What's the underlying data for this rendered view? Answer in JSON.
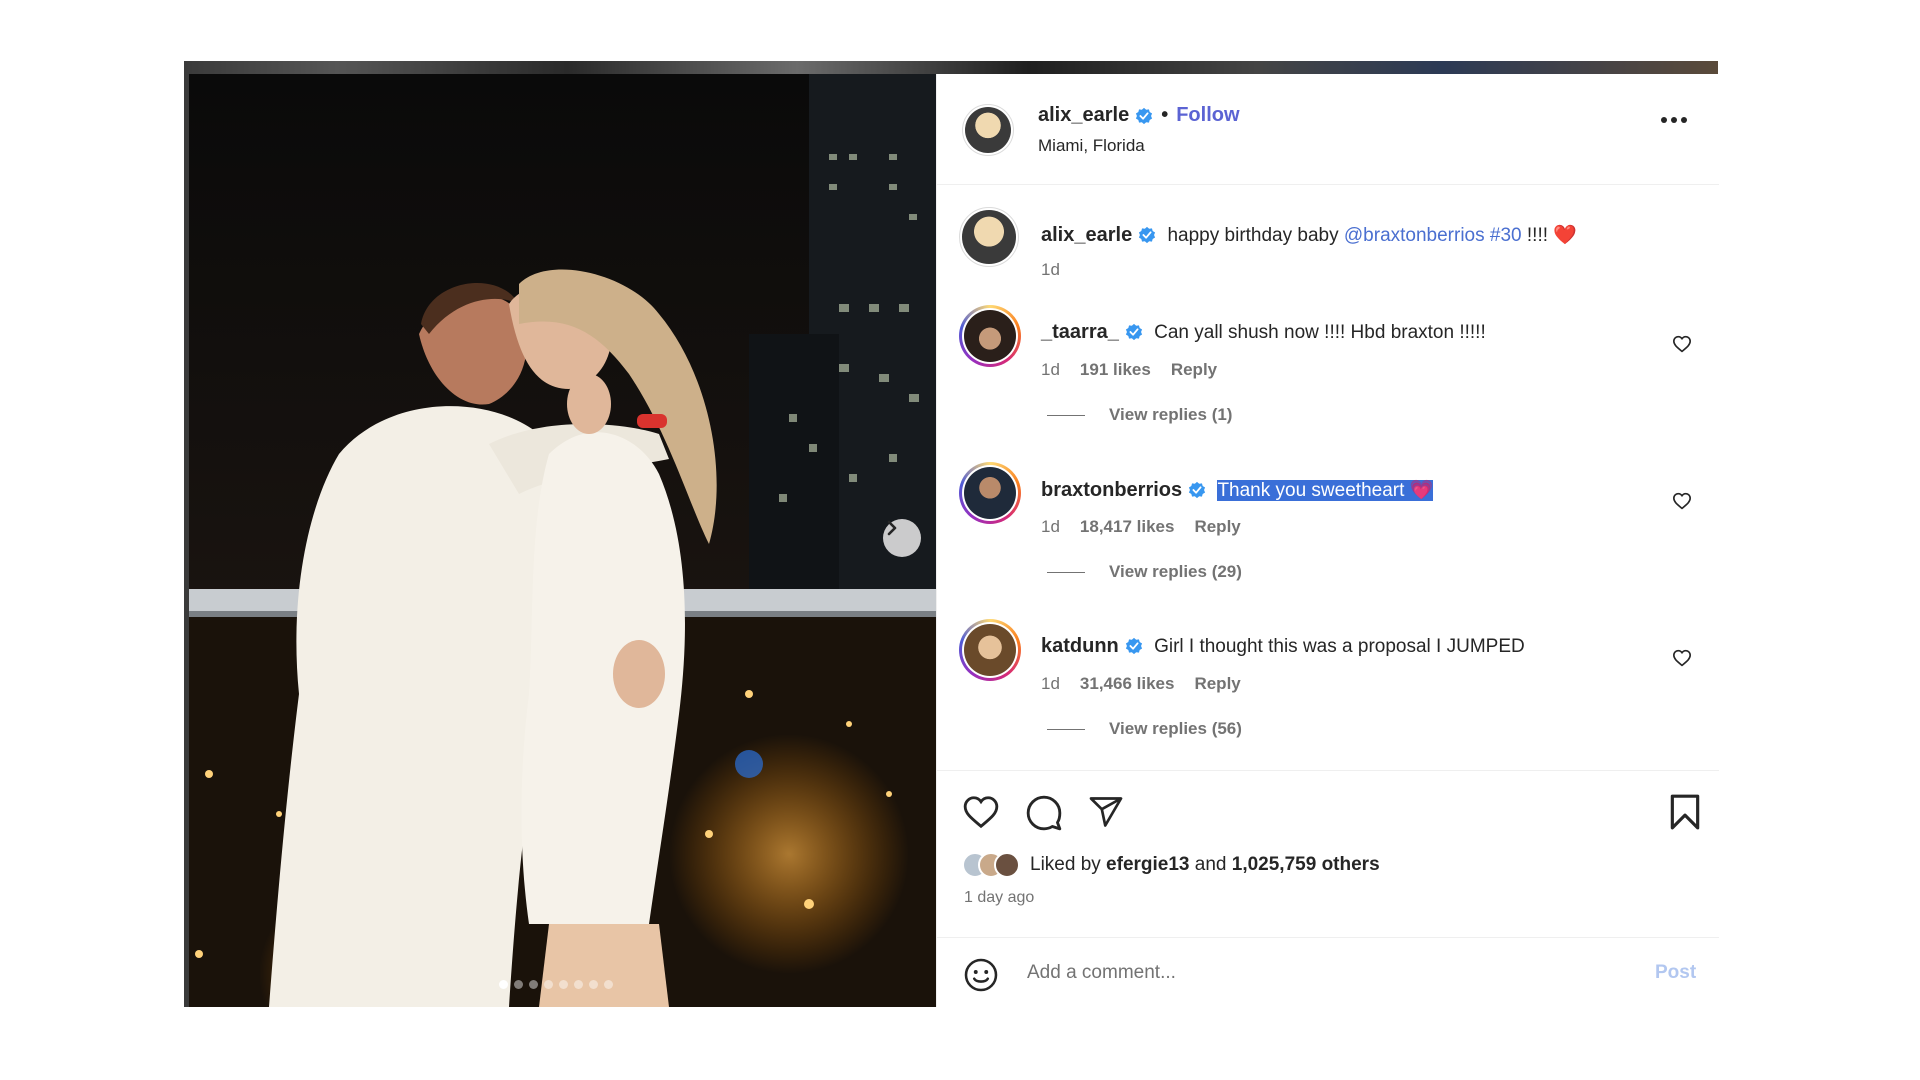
{
  "post": {
    "author": "alix_earle",
    "follow_label": "Follow",
    "separator": "•",
    "location": "Miami, Florida",
    "more_icon": "more-horizontal-icon"
  },
  "media": {
    "next_icon": "chevron-right-icon",
    "slide_count": 8,
    "active_slide": 1
  },
  "caption": {
    "username": "alix_earle",
    "text_prefix": "happy birthday baby ",
    "mention": "@braxtonberrios",
    "hashtag": "#30",
    "text_suffix": " !!!! ❤️",
    "time": "1d"
  },
  "comments": [
    {
      "username": "_taarra_",
      "text": "Can yall shush now !!!! Hbd braxton !!!!!",
      "time": "1d",
      "likes": "191 likes",
      "reply_label": "Reply",
      "view_replies": "View replies (1)"
    },
    {
      "username": "braxtonberrios",
      "text": "Thank you sweetheart 💗",
      "time": "1d",
      "likes": "18,417 likes",
      "reply_label": "Reply",
      "view_replies": "View replies (29)"
    },
    {
      "username": "katdunn",
      "text": "Girl I thought this was a proposal I JUMPED",
      "time": "1d",
      "likes": "31,466 likes",
      "reply_label": "Reply",
      "view_replies": "View replies (56)"
    }
  ],
  "likes_summary": {
    "prefix": "Liked by ",
    "user": "efergie13",
    "middle": " and ",
    "others": "1,025,759 others"
  },
  "posted_time": "1 day ago",
  "comment_box": {
    "placeholder": "Add a comment...",
    "post_label": "Post"
  },
  "colors": {
    "accent": "#5b63d3",
    "verified": "#3897f0",
    "highlight": "#3a6fd8"
  }
}
